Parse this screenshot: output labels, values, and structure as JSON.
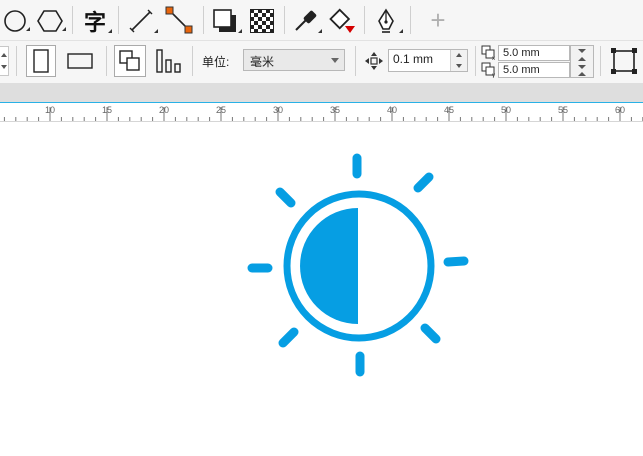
{
  "toolbar_top": {
    "text_tool_glyph": "字",
    "add_glyph": "+"
  },
  "property_bar": {
    "units_label": "单位:",
    "units_value": "毫米",
    "nudge_value": "0.1 mm",
    "duplicate_x": "5.0 mm",
    "duplicate_y": "5.0 mm"
  },
  "ruler": {
    "ticks": [
      "10",
      "15",
      "20",
      "25",
      "30",
      "35",
      "40",
      "45",
      "50",
      "55",
      "60"
    ]
  },
  "canvas": {
    "icon_name": "brightness-contrast-icon",
    "icon_color": "#069ee3"
  },
  "colors": {
    "accent": "#069ee3",
    "toolbar_bg": "#f6f6f6",
    "orange_node": "#e8650c",
    "red_fill": "#d40000"
  }
}
